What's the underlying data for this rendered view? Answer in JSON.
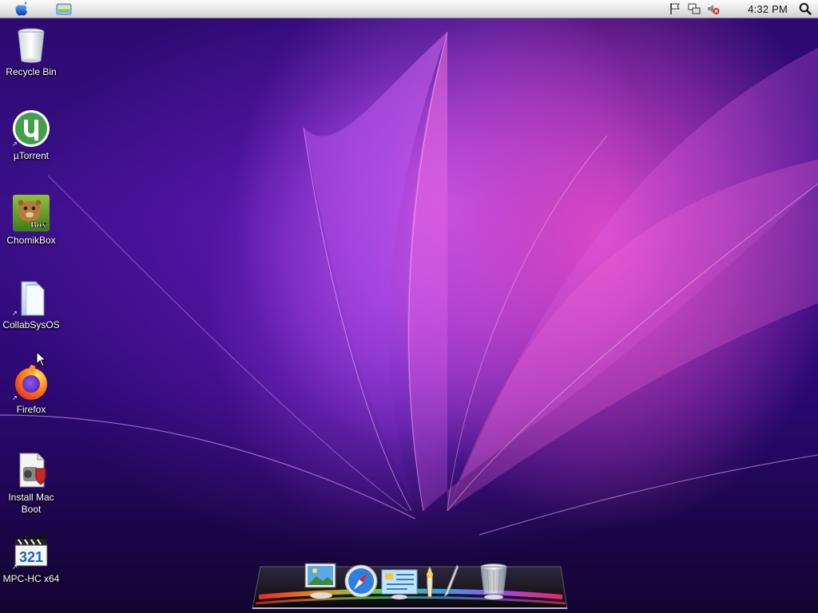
{
  "menubar": {
    "apple_menu_icon": "apple-icon",
    "finder_icon": "finder-icon",
    "tray_icons": [
      "flag-icon",
      "network-icon",
      "volume-muted-icon"
    ],
    "clock": "4:32 PM",
    "spotlight_icon": "search-icon"
  },
  "desktop": {
    "icons": [
      {
        "label": "Recycle Bin",
        "icon": "recycle-bin-icon"
      },
      {
        "label": "µTorrent",
        "icon": "utorrent-icon"
      },
      {
        "label": "ChomikBox",
        "icon": "chomikbox-icon"
      },
      {
        "label": "CollabSysOS",
        "icon": "folder-icon"
      },
      {
        "label": "Firefox",
        "icon": "firefox-icon"
      },
      {
        "label": "Install Mac Boot",
        "icon": "installer-icon"
      },
      {
        "label": "MPC-HC x64",
        "icon": "mpc-hc-icon"
      }
    ],
    "chomikbox_badge": "Box",
    "mpc_badge": "321"
  },
  "dock": {
    "items": [
      "finder-icon",
      "safari-icon",
      "mail-icon",
      "launcher-icon",
      "pen-icon",
      "trash-icon"
    ]
  },
  "colors": {
    "accent_pink": "#f050c8",
    "accent_purple": "#6e1ebe",
    "menubar": "#e6e6e6"
  }
}
